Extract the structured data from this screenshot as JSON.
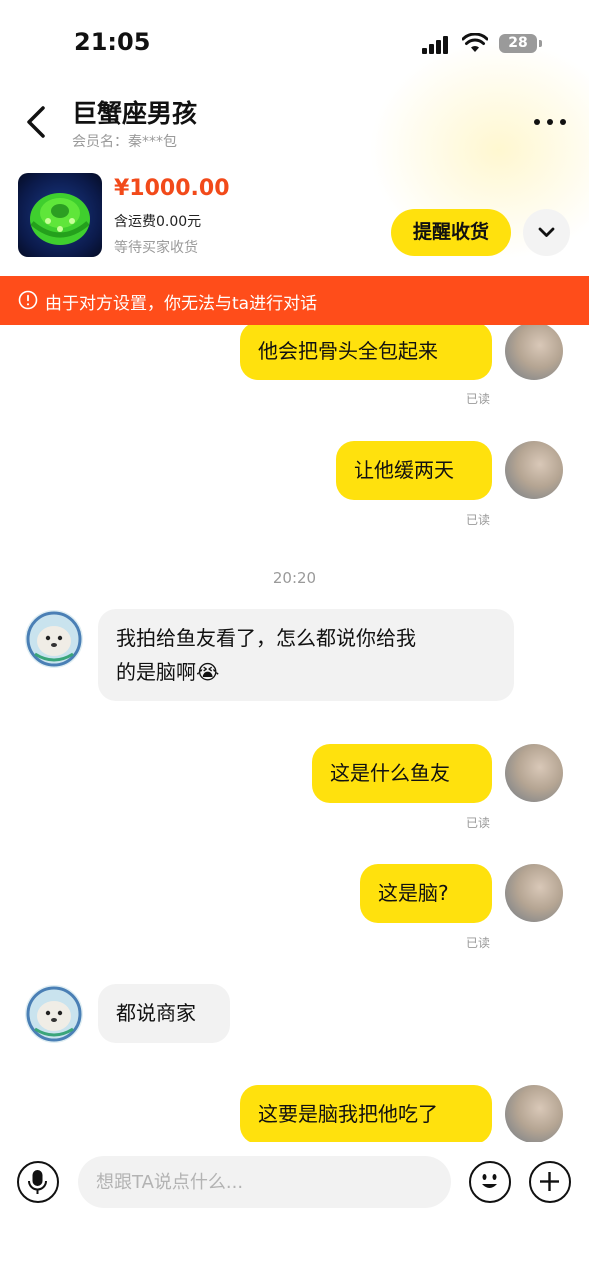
{
  "status_bar": {
    "time": "21:05",
    "battery": "28"
  },
  "header": {
    "title": "巨蟹座男孩",
    "member_label": "会员名：秦***包"
  },
  "product": {
    "price": "¥1000.00",
    "shipping": "含运费0.00元",
    "status": "等待买家收货",
    "remind_label": "提醒收货"
  },
  "banner": {
    "text": "由于对方设置，你无法与ta进行对话"
  },
  "chat": {
    "time_divider": "20:20",
    "messages": [
      {
        "from": "me",
        "text": "他会把骨头全包起来",
        "read": "已读"
      },
      {
        "from": "me",
        "text": "让他缓两天",
        "read": "已读"
      },
      {
        "from": "them",
        "line1": "我拍给鱼友看了，怎么都说你给我",
        "line2": "的是脑啊😭"
      },
      {
        "from": "me",
        "text": "这是什么鱼友",
        "read": "已读"
      },
      {
        "from": "me",
        "text": "这是脑?",
        "read": "已读"
      },
      {
        "from": "them",
        "text": "都说商家"
      },
      {
        "from": "me",
        "text": "这要是脑我把他吃了"
      }
    ]
  },
  "input": {
    "placeholder": "想跟TA说点什么..."
  },
  "colors": {
    "accent_yellow": "#ffe10d",
    "price_red": "#f24a1a",
    "banner_orange": "#ff4d1a"
  }
}
